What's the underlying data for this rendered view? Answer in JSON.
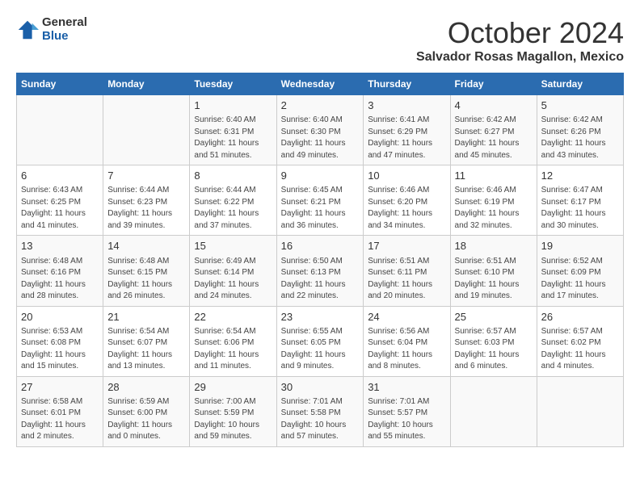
{
  "logo": {
    "general": "General",
    "blue": "Blue"
  },
  "title": "October 2024",
  "subtitle": "Salvador Rosas Magallon, Mexico",
  "days_header": [
    "Sunday",
    "Monday",
    "Tuesday",
    "Wednesday",
    "Thursday",
    "Friday",
    "Saturday"
  ],
  "weeks": [
    [
      {
        "day": "",
        "info": ""
      },
      {
        "day": "",
        "info": ""
      },
      {
        "day": "1",
        "info": "Sunrise: 6:40 AM\nSunset: 6:31 PM\nDaylight: 11 hours and 51 minutes."
      },
      {
        "day": "2",
        "info": "Sunrise: 6:40 AM\nSunset: 6:30 PM\nDaylight: 11 hours and 49 minutes."
      },
      {
        "day": "3",
        "info": "Sunrise: 6:41 AM\nSunset: 6:29 PM\nDaylight: 11 hours and 47 minutes."
      },
      {
        "day": "4",
        "info": "Sunrise: 6:42 AM\nSunset: 6:27 PM\nDaylight: 11 hours and 45 minutes."
      },
      {
        "day": "5",
        "info": "Sunrise: 6:42 AM\nSunset: 6:26 PM\nDaylight: 11 hours and 43 minutes."
      }
    ],
    [
      {
        "day": "6",
        "info": "Sunrise: 6:43 AM\nSunset: 6:25 PM\nDaylight: 11 hours and 41 minutes."
      },
      {
        "day": "7",
        "info": "Sunrise: 6:44 AM\nSunset: 6:23 PM\nDaylight: 11 hours and 39 minutes."
      },
      {
        "day": "8",
        "info": "Sunrise: 6:44 AM\nSunset: 6:22 PM\nDaylight: 11 hours and 37 minutes."
      },
      {
        "day": "9",
        "info": "Sunrise: 6:45 AM\nSunset: 6:21 PM\nDaylight: 11 hours and 36 minutes."
      },
      {
        "day": "10",
        "info": "Sunrise: 6:46 AM\nSunset: 6:20 PM\nDaylight: 11 hours and 34 minutes."
      },
      {
        "day": "11",
        "info": "Sunrise: 6:46 AM\nSunset: 6:19 PM\nDaylight: 11 hours and 32 minutes."
      },
      {
        "day": "12",
        "info": "Sunrise: 6:47 AM\nSunset: 6:17 PM\nDaylight: 11 hours and 30 minutes."
      }
    ],
    [
      {
        "day": "13",
        "info": "Sunrise: 6:48 AM\nSunset: 6:16 PM\nDaylight: 11 hours and 28 minutes."
      },
      {
        "day": "14",
        "info": "Sunrise: 6:48 AM\nSunset: 6:15 PM\nDaylight: 11 hours and 26 minutes."
      },
      {
        "day": "15",
        "info": "Sunrise: 6:49 AM\nSunset: 6:14 PM\nDaylight: 11 hours and 24 minutes."
      },
      {
        "day": "16",
        "info": "Sunrise: 6:50 AM\nSunset: 6:13 PM\nDaylight: 11 hours and 22 minutes."
      },
      {
        "day": "17",
        "info": "Sunrise: 6:51 AM\nSunset: 6:11 PM\nDaylight: 11 hours and 20 minutes."
      },
      {
        "day": "18",
        "info": "Sunrise: 6:51 AM\nSunset: 6:10 PM\nDaylight: 11 hours and 19 minutes."
      },
      {
        "day": "19",
        "info": "Sunrise: 6:52 AM\nSunset: 6:09 PM\nDaylight: 11 hours and 17 minutes."
      }
    ],
    [
      {
        "day": "20",
        "info": "Sunrise: 6:53 AM\nSunset: 6:08 PM\nDaylight: 11 hours and 15 minutes."
      },
      {
        "day": "21",
        "info": "Sunrise: 6:54 AM\nSunset: 6:07 PM\nDaylight: 11 hours and 13 minutes."
      },
      {
        "day": "22",
        "info": "Sunrise: 6:54 AM\nSunset: 6:06 PM\nDaylight: 11 hours and 11 minutes."
      },
      {
        "day": "23",
        "info": "Sunrise: 6:55 AM\nSunset: 6:05 PM\nDaylight: 11 hours and 9 minutes."
      },
      {
        "day": "24",
        "info": "Sunrise: 6:56 AM\nSunset: 6:04 PM\nDaylight: 11 hours and 8 minutes."
      },
      {
        "day": "25",
        "info": "Sunrise: 6:57 AM\nSunset: 6:03 PM\nDaylight: 11 hours and 6 minutes."
      },
      {
        "day": "26",
        "info": "Sunrise: 6:57 AM\nSunset: 6:02 PM\nDaylight: 11 hours and 4 minutes."
      }
    ],
    [
      {
        "day": "27",
        "info": "Sunrise: 6:58 AM\nSunset: 6:01 PM\nDaylight: 11 hours and 2 minutes."
      },
      {
        "day": "28",
        "info": "Sunrise: 6:59 AM\nSunset: 6:00 PM\nDaylight: 11 hours and 0 minutes."
      },
      {
        "day": "29",
        "info": "Sunrise: 7:00 AM\nSunset: 5:59 PM\nDaylight: 10 hours and 59 minutes."
      },
      {
        "day": "30",
        "info": "Sunrise: 7:01 AM\nSunset: 5:58 PM\nDaylight: 10 hours and 57 minutes."
      },
      {
        "day": "31",
        "info": "Sunrise: 7:01 AM\nSunset: 5:57 PM\nDaylight: 10 hours and 55 minutes."
      },
      {
        "day": "",
        "info": ""
      },
      {
        "day": "",
        "info": ""
      }
    ]
  ]
}
